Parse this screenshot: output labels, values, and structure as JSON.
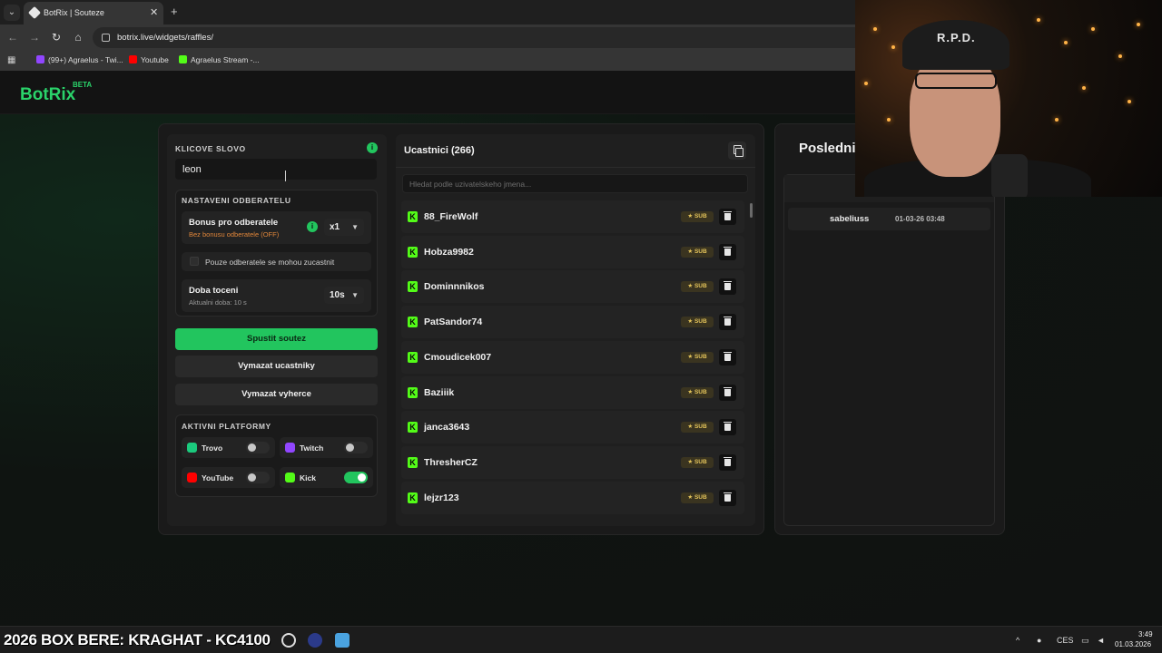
{
  "browser": {
    "tab_title": "BotRix | Souteze",
    "tab_close": "✕",
    "new_tab": "+",
    "url": "botrix.live/widgets/raffles/",
    "bookmarks": [
      "(99+) Agraelus - Twi...",
      "Youtube",
      "Agraelus Stream -..."
    ]
  },
  "app": {
    "logo": "BotRix",
    "logo_badge": "BETA"
  },
  "left": {
    "keyword_label": "KLICOVE SLOVO",
    "keyword_value": "leon",
    "sub_settings_label": "NASTAVENI ODBERATELU",
    "bonus_title": "Bonus pro odberatele",
    "bonus_sub": "Bez bonusu odberatele (OFF)",
    "bonus_select": "x1",
    "subs_only_label": "Pouze odberatele se mohou zucastnit",
    "spin_title": "Doba toceni",
    "spin_sub": "Aktualni doba: 10 s",
    "spin_select": "10s",
    "start_button": "Spustit soutez",
    "clear_participants_button": "Vymazat ucastniky",
    "clear_winners_button": "Vymazat vyherce",
    "platforms_label": "AKTIVNI PLATFORMY",
    "platforms": [
      {
        "name": "Trovo",
        "enabled": false,
        "color": "#1bca7d"
      },
      {
        "name": "Twitch",
        "enabled": false,
        "color": "#9146ff"
      },
      {
        "name": "YouTube",
        "enabled": false,
        "color": "#ff0000"
      },
      {
        "name": "Kick",
        "enabled": true,
        "color": "#53fc18"
      }
    ]
  },
  "participants": {
    "title": "Ucastnici (266)",
    "search_placeholder": "Hledat podle uzivatelskeho jmena...",
    "sub_badge": "★ SUB",
    "platform_icon": "kick-icon",
    "list": [
      "88_FireWolf",
      "Hobza9982",
      "Dominnnikos",
      "PatSandor74",
      "Cmoudicek007",
      "Baziiik",
      "janca3643",
      "ThresherCZ",
      "lejzr123"
    ]
  },
  "winners": {
    "title": "Posledni",
    "list": [
      {
        "name": "sabeliuss",
        "date": "01-03-26 03:48"
      }
    ]
  },
  "webcam": {
    "cap_text": "R.P.D."
  },
  "taskbar": {
    "ticker": "2026 BOX BERE: KRAGHAT - KC4100",
    "lang": "CES",
    "time": "3:49",
    "date": "01.03.2026"
  },
  "colors": {
    "accent": "#22c55e",
    "kick": "#53fc18"
  }
}
